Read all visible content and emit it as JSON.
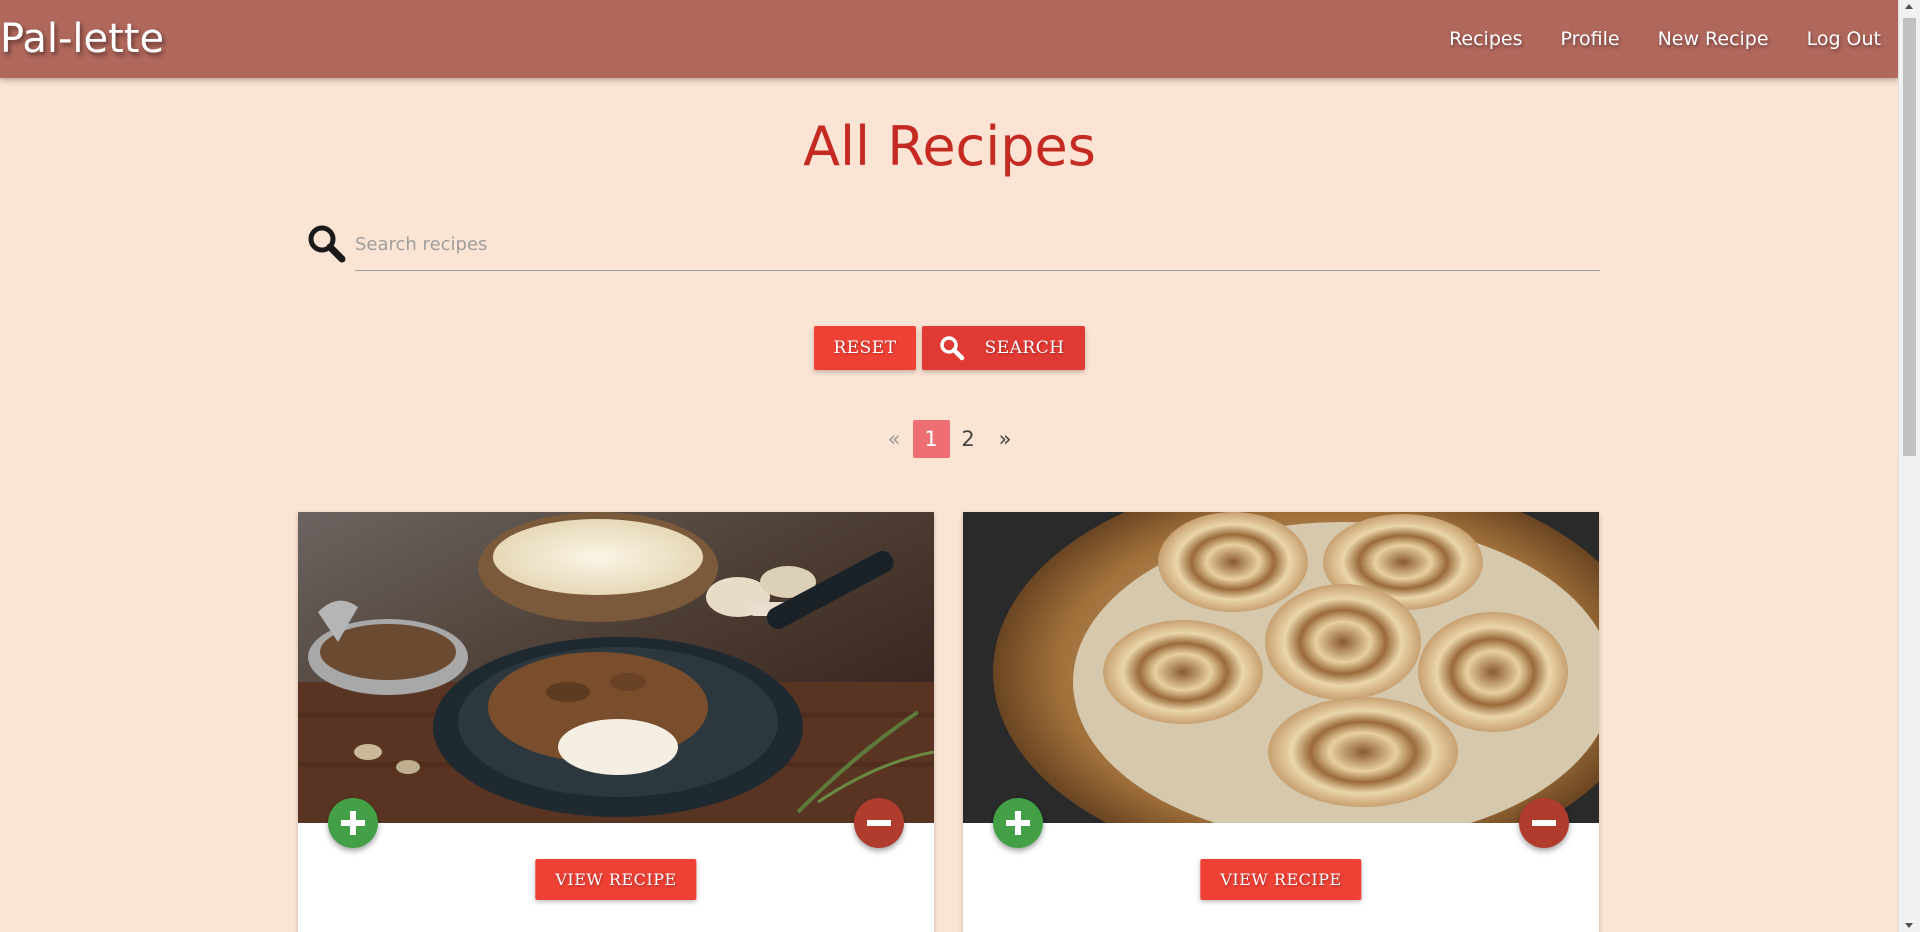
{
  "navbar": {
    "brand": "Pal-lette",
    "links": [
      "Recipes",
      "Profile",
      "New Recipe",
      "Log Out"
    ]
  },
  "main": {
    "title": "All Recipes",
    "search": {
      "placeholder": "Search recipes",
      "value": ""
    },
    "buttons": {
      "reset": "RESET",
      "search": "SEARCH"
    },
    "pagination": {
      "prev": "«",
      "pages": [
        "1",
        "2"
      ],
      "active": "1",
      "next": "»"
    }
  },
  "cards": [
    {
      "image": "mashed potatoes with mushroom gravy in cast iron skillet",
      "view_label": "VIEW RECIPE",
      "add_icon": "plus-icon",
      "remove_icon": "minus-icon"
    },
    {
      "image": "cinnamon roll pinwheels on a copper plate",
      "view_label": "VIEW RECIPE",
      "add_icon": "plus-icon",
      "remove_icon": "minus-icon"
    }
  ],
  "colors": {
    "navbar": "#b0675c",
    "background": "#fce4d4",
    "title": "#c52a22",
    "button": "#ef4035",
    "pagination_active": "#ee6e73",
    "add_fab": "#43a047",
    "remove_fab": "#b03c2e"
  }
}
